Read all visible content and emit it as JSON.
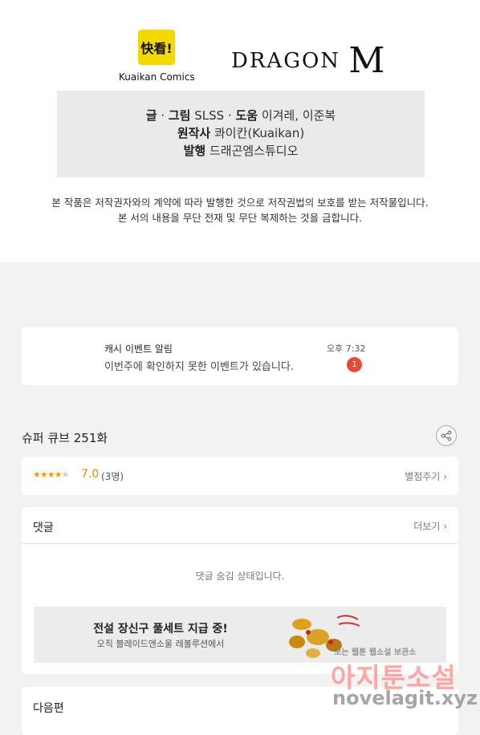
{
  "logos": {
    "kuaikan_mark": "快看!",
    "kuaikan_name": "Kuaikan Comics",
    "dragon_text": "DRAGON",
    "dragon_m": "M"
  },
  "credits": {
    "writer_label": "글",
    "artist_label": "그림",
    "author": "SLSS",
    "help_label": "도움",
    "helpers": "이겨레, 이준복",
    "original_label": "원작사",
    "original": "콰이칸(Kuaikan)",
    "publisher_label": "발행",
    "publisher": "드래곤엠스튜디오"
  },
  "notice": {
    "line1": "본 작품은 저작권자와의 계약에 따라 발행한 것으로 저작권법의 보호를 받는 저작물입니다.",
    "line2": "본 서의 내용을 무단 전재 및 무단 복제하는 것을 금합니다."
  },
  "cash_event": {
    "title": "캐시 이벤트 알림",
    "description": "이번주에 확인하지 못한 이벤트가 있습니다.",
    "time": "오후 7:32",
    "badge_count": "1"
  },
  "episode": {
    "title": "슈퍼 큐브 251화",
    "share_icon": "share-icon"
  },
  "rating": {
    "stars_filled": "★★★★",
    "stars_empty": "★",
    "value": 3.5,
    "score": "7.0",
    "count": "(3명)",
    "rate_link": "별점주기"
  },
  "comments": {
    "header": "댓글",
    "more": "더보기",
    "hidden_message": "댓글 숨김 상태입니다."
  },
  "banner": {
    "title": "전설 장신구 풀세트 지급 중!",
    "subtitle": "오직 블레이드앤소울 레볼루션에서"
  },
  "next": {
    "label": "다음편"
  },
  "watermark": {
    "small": "보는 웹툰 웹소설 보관소",
    "big": "아지툰소설",
    "url": "novelagit.xyz"
  },
  "colors": {
    "accent_star": "#f0a100",
    "badge": "#e34c3b",
    "credits_bg": "#ebe9e9",
    "page_bg": "#f2f2f2"
  }
}
